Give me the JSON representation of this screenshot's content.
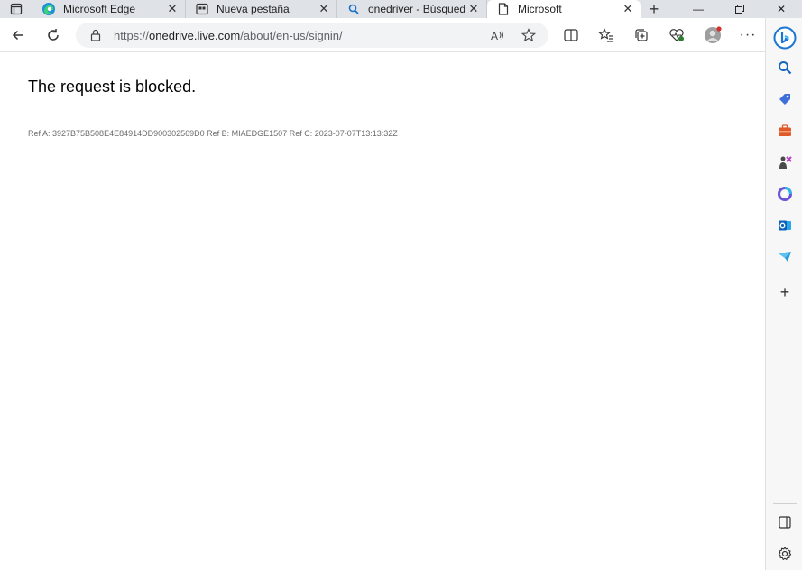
{
  "tabs": [
    {
      "title": "Microsoft Edge",
      "icon": "edge-icon"
    },
    {
      "title": "Nueva pestaña",
      "icon": "new-tab-page-icon"
    },
    {
      "title": "onedriver - Búsqueda",
      "icon": "search-icon"
    },
    {
      "title": "Microsoft",
      "icon": "page-icon",
      "active": true
    }
  ],
  "toolbar": {
    "url_scheme": "https://",
    "url_host": "onedrive.live.com",
    "url_path": "/about/en-us/signin/"
  },
  "page": {
    "heading": "The request is blocked.",
    "ref_text": "Ref A: 3927B75B508E4E84914DD900302569D0 Ref B: MIAEDGE1507 Ref C: 2023-07-07T13:13:32Z"
  },
  "sidebar": {
    "items": [
      "bing-chat-icon",
      "search-icon",
      "shopping-tag-icon",
      "tools-briefcase-icon",
      "games-icon",
      "microsoft-365-icon",
      "outlook-icon",
      "drop-icon",
      "add-icon"
    ],
    "bottom": [
      "sidebar-toggle-icon",
      "settings-icon"
    ]
  },
  "colors": {
    "tabstrip": "#dfe3e8",
    "address_bar": "#f1f3f4",
    "accent": "#0c59a4"
  }
}
